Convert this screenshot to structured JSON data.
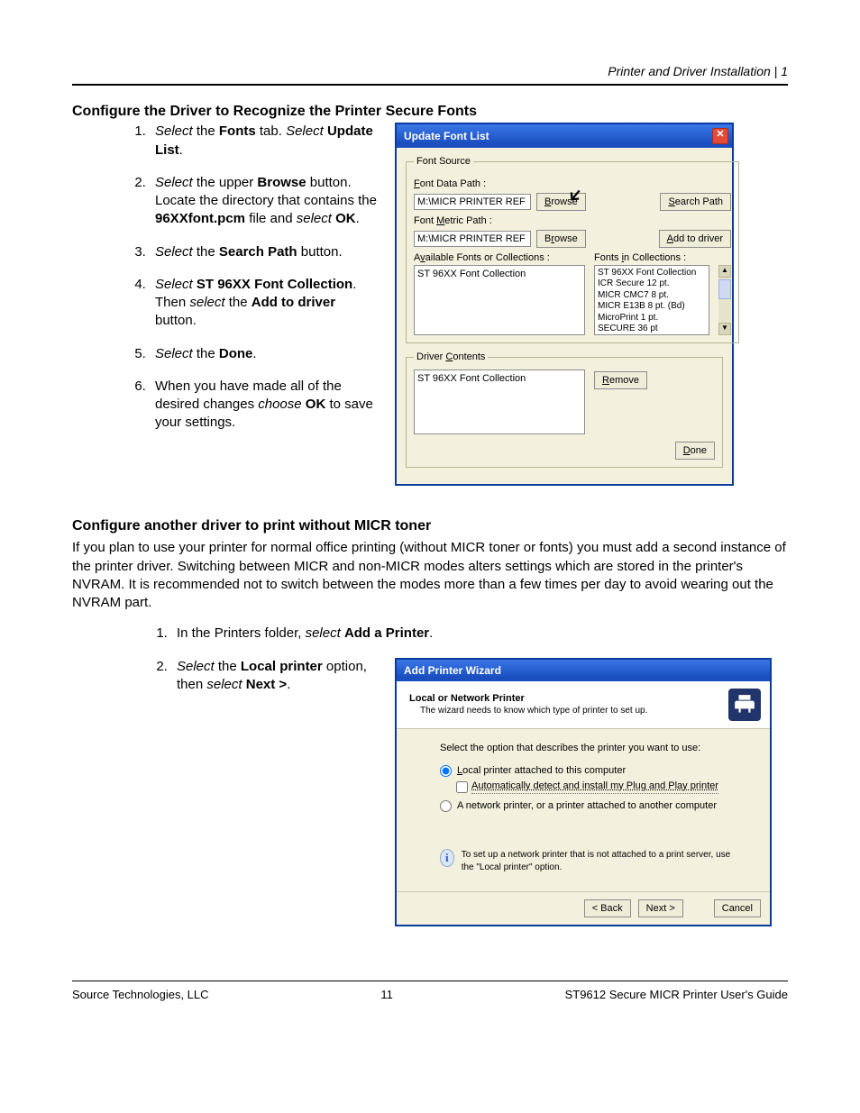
{
  "header": {
    "right": "Printer and Driver Installation  |  1"
  },
  "section1": {
    "title": "Configure the Driver to Recognize the Printer Secure Fonts",
    "steps": [
      {
        "pre": "Select",
        "mid1": " the ",
        "b1": "Fonts",
        "mid2": " tab.  ",
        "pre2": "Select",
        "mid3": " ",
        "b2": "Update List",
        "tail": "."
      },
      {
        "pre": "Select",
        "mid1": " the upper ",
        "b1": "Browse",
        "mid2": " button.  Locate the directory that contains the ",
        "b2": "96XXfont.pcm",
        "mid3": " file and ",
        "pre2": "select",
        "mid4": " ",
        "b3": "OK",
        "tail": "."
      },
      {
        "pre": "Select",
        "mid1": " the ",
        "b1": "Search Path",
        "mid2": " button.",
        "tail": ""
      },
      {
        "pre": "Select",
        "mid1": " ",
        "b1": "ST 96XX Font Collection",
        "mid2": ".  Then ",
        "pre2": "select",
        "mid3": " the ",
        "b2": "Add to driver",
        "mid4": " button.",
        "tail": ""
      },
      {
        "pre": "Select",
        "mid1": " the ",
        "b1": "Done",
        "tail": "."
      },
      {
        "plain1": "When you have made all of the desired changes ",
        "pre": "choose",
        "mid1": " ",
        "b1": "OK",
        "mid2": " to save your settings.",
        "tail": ""
      }
    ]
  },
  "dialog1": {
    "title": "Update Font List",
    "fontSourceLegend": "Font Source",
    "fontDataPathLabel": "Font Data Path :",
    "fontDataPathValue": "M:\\MICR PRINTER REF",
    "fontMetricPathLabel": "Font Metric Path :",
    "fontMetricPathValue": "M:\\MICR PRINTER REF",
    "browse": "Browse",
    "searchPath": "Search Path",
    "addToDriver": "Add to driver",
    "availableLabel": "Available Fonts or Collections :",
    "inCollectionsLabel": "Fonts in Collections :",
    "availItem": "ST 96XX Font Collection",
    "collItems": [
      "ST 96XX Font Collection",
      "ICR Secure 12 pt.",
      "MICR CMC7 8 pt.",
      "MICR E13B 8 pt. (Bd)",
      "MicroPrint 1 pt.",
      "SECURE 36 pt"
    ],
    "driverContentsLegend": "Driver Contents",
    "driverItem": "ST 96XX Font Collection",
    "remove": "Remove",
    "done": "Done"
  },
  "section2": {
    "title": "Configure another driver to print without MICR toner",
    "body": "If you plan to use your printer for normal office printing (without MICR toner or fonts) you must add a second instance of the printer driver.  Switching between MICR and non-MICR modes alters settings which are stored in the printer's NVRAM.  It is recommended not to switch between the modes more than a few times per day to avoid wearing out the NVRAM part.",
    "step1_pre": "In the Printers folder, ",
    "step1_ital": "select",
    "step1_sp": " ",
    "step1_b": "Add a Printer",
    "step1_tail": ".",
    "step2_ital1": "Select",
    "step2_mid1": " the ",
    "step2_b1": "Local printer",
    "step2_mid2": " option, then ",
    "step2_ital2": "select",
    "step2_sp": " ",
    "step2_b2": "Next >",
    "step2_tail": "."
  },
  "dialog2": {
    "title": "Add Printer Wizard",
    "headTitle": "Local or Network Printer",
    "headSub": "The wizard needs to know which type of printer to set up.",
    "prompt": "Select the option that describes the printer you want to use:",
    "opt1": "Local printer attached to this computer",
    "opt1chk": "Automatically detect and install my Plug and Play printer",
    "opt2": "A network printer, or a printer attached to another computer",
    "info": "To set up a network printer that is not attached to a print server, use the \"Local printer\" option.",
    "back": "< Back",
    "next": "Next >",
    "cancel": "Cancel"
  },
  "footer": {
    "left": "Source Technologies, LLC",
    "center": "11",
    "right": "ST9612 Secure MICR Printer User's Guide"
  }
}
